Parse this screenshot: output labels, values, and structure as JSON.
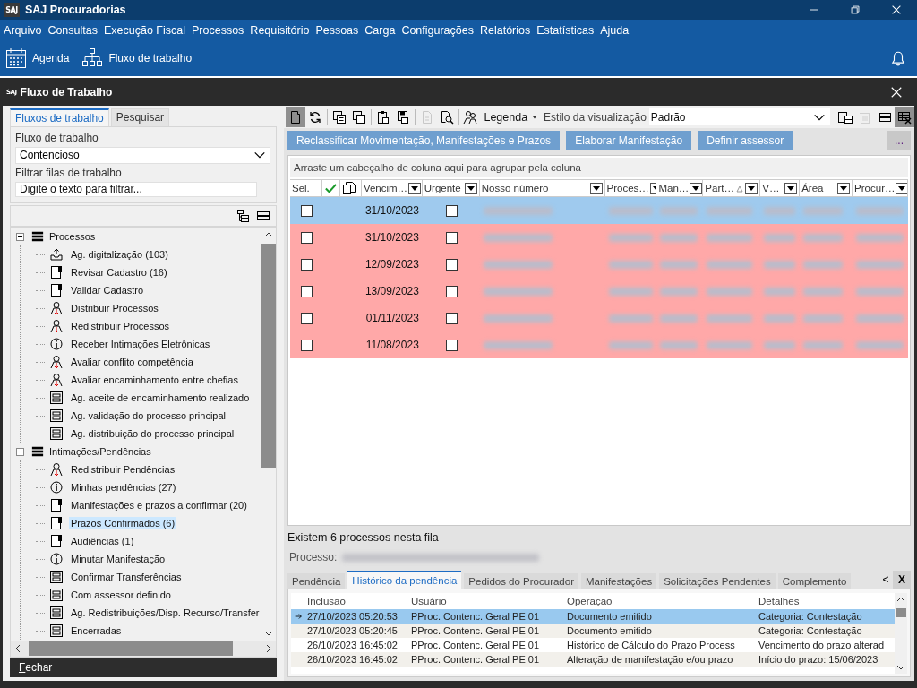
{
  "app": {
    "logo": "SAJ",
    "title": "SAJ Procuradorias"
  },
  "menu": [
    "Arquivo",
    "Consultas",
    "Execução Fiscal",
    "Processos",
    "Requisitório",
    "Pessoas",
    "Carga",
    "Configurações",
    "Relatórios",
    "Estatísticas",
    "Ajuda"
  ],
  "shortcuts": [
    {
      "label": "Agenda",
      "kind": "calendar"
    },
    {
      "label": "Fluxo de trabalho",
      "kind": "workflow"
    }
  ],
  "window": {
    "logo": "SAJ",
    "title": "Fluxo de Trabalho"
  },
  "left_panel": {
    "tabs": [
      {
        "label": "Fluxos de trabalho",
        "selected": true
      },
      {
        "label": "Pesquisar",
        "selected": false
      }
    ],
    "workflow_label": "Fluxo de trabalho",
    "workflow_value": "Contencioso",
    "filter_label": "Filtrar filas de trabalho",
    "filter_placeholder": "Digite o texto para filtrar...",
    "tree": [
      {
        "label": "Processos",
        "expanded": true,
        "children": [
          {
            "label": "Ag. digitalização (103)",
            "kind": "scan",
            "selected": false
          },
          {
            "label": "Revisar Cadastro (16)",
            "kind": "flag",
            "selected": false
          },
          {
            "label": "Validar Cadastro",
            "kind": "flag",
            "selected": false
          },
          {
            "label": "Distribuir Processos",
            "kind": "user",
            "selected": false
          },
          {
            "label": "Redistribuir Processos",
            "kind": "user",
            "selected": false
          },
          {
            "label": "Receber Intimações Eletrônicas",
            "kind": "info",
            "selected": false
          },
          {
            "label": "Avaliar conflito competência",
            "kind": "user",
            "selected": false
          },
          {
            "label": "Avaliar encaminhamento entre chefias",
            "kind": "user",
            "selected": false
          },
          {
            "label": "Ag. aceite de encaminhamento realizado",
            "kind": "form",
            "selected": false
          },
          {
            "label": "Ag. validação do processo principal",
            "kind": "form",
            "selected": false
          },
          {
            "label": "Ag. distribuição do processo principal",
            "kind": "form",
            "selected": false
          }
        ]
      },
      {
        "label": "Intimações/Pendências",
        "expanded": true,
        "children": [
          {
            "label": "Redistribuir Pendências",
            "kind": "user",
            "selected": false
          },
          {
            "label": "Minhas pendências (27)",
            "kind": "info",
            "selected": false
          },
          {
            "label": "Manifestações e prazos a confirmar (20)",
            "kind": "flag",
            "selected": false
          },
          {
            "label": "Prazos Confirmados (6)",
            "kind": "flag",
            "selected": true
          },
          {
            "label": "Audiências (1)",
            "kind": "flag",
            "selected": false
          },
          {
            "label": "Minutar Manifestação",
            "kind": "info",
            "selected": false
          },
          {
            "label": "Confirmar Transferências",
            "kind": "form",
            "selected": false
          },
          {
            "label": "Com assessor definido",
            "kind": "form",
            "selected": false
          },
          {
            "label": "Ag. Redistribuições/Disp. Recurso/Transfer",
            "kind": "form",
            "selected": false
          },
          {
            "label": "Encerradas",
            "kind": "form",
            "selected": false
          }
        ]
      }
    ],
    "close_button": "Fechar"
  },
  "toolbar": {
    "tools": [
      {
        "kind": "page",
        "pressed": true,
        "disabled": false
      },
      {
        "kind": "refresh",
        "pressed": false,
        "disabled": false
      },
      {
        "kind": "check-copy",
        "pressed": false,
        "disabled": false
      },
      {
        "kind": "copy",
        "pressed": false,
        "disabled": false
      },
      {
        "kind": "clipboard",
        "pressed": false,
        "disabled": false
      },
      {
        "kind": "save",
        "pressed": false,
        "disabled": false
      },
      {
        "kind": "doc",
        "pressed": false,
        "disabled": true
      },
      {
        "kind": "search-doc",
        "pressed": false,
        "disabled": false
      },
      {
        "kind": "people",
        "pressed": false,
        "disabled": false
      }
    ],
    "legend": "Legenda",
    "view_style_label": "Estilo da visualização",
    "view_style": "Padrão",
    "view_tools": [
      {
        "kind": "layout",
        "pressed": false,
        "disabled": false
      },
      {
        "kind": "trash",
        "pressed": false,
        "disabled": true
      },
      {
        "kind": "panels",
        "pressed": false,
        "disabled": false
      },
      {
        "kind": "grid-off",
        "pressed": true,
        "disabled": false
      }
    ]
  },
  "actions": [
    "Reclassificar Movimentação, Manifestações e Prazos",
    "Elaborar Manifestação",
    "Definir assessor"
  ],
  "more_button": "...",
  "grid": {
    "group_hint": "Arraste um cabeçalho de coluna aqui para agrupar pela coluna",
    "columns": [
      {
        "kind": "text",
        "label": "Sel.",
        "filter": false,
        "sorted": false
      },
      {
        "kind": "check"
      },
      {
        "kind": "docs"
      },
      {
        "kind": "text",
        "label": "Vencim…",
        "filter": true,
        "sorted": false
      },
      {
        "kind": "text",
        "label": "Urgente",
        "filter": true,
        "sorted": false
      },
      {
        "kind": "text",
        "label": "Nosso número",
        "filter": true,
        "sorted": false
      },
      {
        "kind": "text",
        "label": "Proces…",
        "filter": true,
        "sorted": false
      },
      {
        "kind": "text",
        "label": "Man…",
        "filter": true,
        "sorted": false
      },
      {
        "kind": "text",
        "label": "Part…",
        "filter": true,
        "sorted": true
      },
      {
        "kind": "text",
        "label": "V…",
        "filter": true,
        "sorted": false
      },
      {
        "kind": "text",
        "label": "Área",
        "filter": true,
        "sorted": false
      },
      {
        "kind": "text",
        "label": "Procur…",
        "filter": true,
        "sorted": false
      }
    ],
    "rows": [
      {
        "selected": true,
        "checked": false,
        "due": "31/10/2023",
        "urgent": false
      },
      {
        "selected": false,
        "checked": false,
        "due": "31/10/2023",
        "urgent": false,
        "color": "#ffa8a8"
      },
      {
        "selected": false,
        "checked": false,
        "due": "12/09/2023",
        "urgent": false,
        "color": "#ffa8a8"
      },
      {
        "selected": false,
        "checked": false,
        "due": "13/09/2023",
        "urgent": false,
        "color": "#ffa8a8"
      },
      {
        "selected": false,
        "checked": false,
        "due": "01/11/2023",
        "urgent": false,
        "color": "#ffa8a8"
      },
      {
        "selected": false,
        "checked": false,
        "due": "11/08/2023",
        "urgent": false,
        "color": "#ffa8a8"
      }
    ]
  },
  "status_text": "Existem 6 processos nesta fila",
  "process_label": "Processo:",
  "detail_tabs": [
    {
      "label": "Pendência",
      "selected": false
    },
    {
      "label": "Histórico da pendência",
      "selected": true
    },
    {
      "label": "Pedidos do Procurador",
      "selected": false
    },
    {
      "label": "Manifestações",
      "selected": false
    },
    {
      "label": "Solicitações Pendentes",
      "selected": false
    },
    {
      "label": "Complemento",
      "selected": false
    }
  ],
  "tab_nav": {
    "previous": "<",
    "close": "X"
  },
  "history": {
    "columns": [
      "Inclusão",
      "Usuário",
      "Operação",
      "Detalhes"
    ],
    "rows": [
      {
        "selected": true,
        "cells": [
          "27/10/2023 05:20:53",
          "PProc. Contenc. Geral PE 01",
          "Documento emitido",
          "Categoria: Contestação"
        ]
      },
      {
        "selected": false,
        "cells": [
          "27/10/2023 05:20:45",
          "PProc. Contenc. Geral PE 01",
          "Documento emitido",
          "Categoria: Contestação"
        ]
      },
      {
        "selected": false,
        "cells": [
          "26/10/2023 16:45:02",
          "PProc. Contenc. Geral PE 01",
          "Histórico de Cálculo do Prazo Process",
          "Vencimento do prazo alterad"
        ]
      },
      {
        "selected": false,
        "cells": [
          "26/10/2023 16:45:02",
          "PProc. Contenc. Geral PE 01",
          "Alteração de manifestação e/ou prazo",
          "Início do prazo: 15/06/2023"
        ]
      }
    ]
  }
}
